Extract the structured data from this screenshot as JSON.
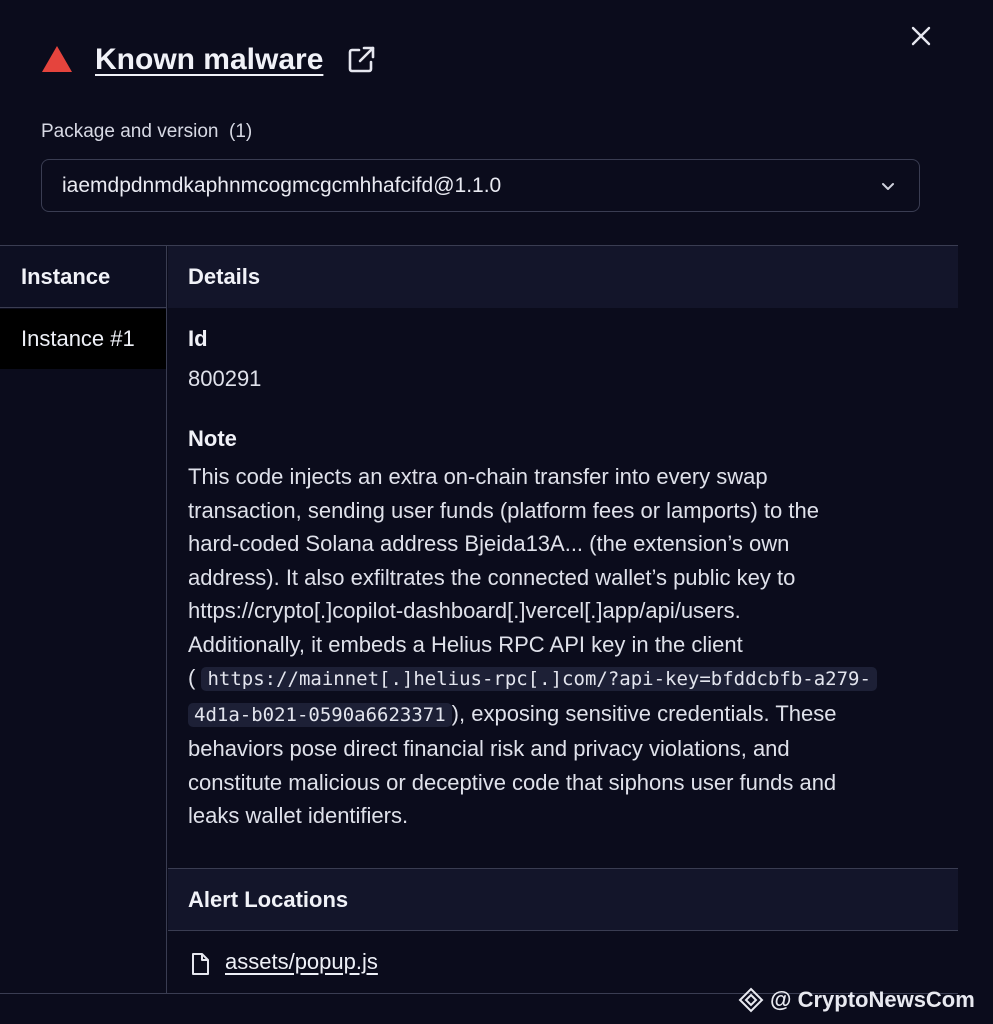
{
  "header": {
    "title": "Known malware",
    "package_label": "Package and version",
    "package_count": "(1)",
    "package_value": "iaemdpdnmdkaphnmcogmcgcmhhafcifd@1.1.0"
  },
  "instances": {
    "header": "Instance",
    "items": [
      "Instance #1"
    ]
  },
  "details": {
    "header": "Details",
    "id_label": "Id",
    "id_value": "800291",
    "note_label": "Note",
    "note_lines": [
      "This code injects an extra on-chain transfer into every swap",
      "transaction, sending user funds (platform fees or lamports) to the",
      "hard-coded Solana address Bjeida13A... (the extension’s own",
      "address). It also exfiltrates the connected wallet’s public key to",
      "https://crypto[.]copilot-dashboard[.]vercel[.]app/api/users.",
      "Additionally, it embeds a Helius RPC API key in the client"
    ],
    "note_code_prefix": "(",
    "note_code_1": "https://mainnet[.]helius-rpc[.]com/?api-key=bfddcbfb-a279-",
    "note_code_2": "4d1a-b021-0590a6623371",
    "note_after_code": "), exposing sensitive credentials. These",
    "note_tail_lines": [
      "behaviors pose direct financial risk and privacy violations, and",
      "constitute malicious or deceptive code that siphons user funds and",
      "leaks wallet identifiers."
    ]
  },
  "alert_locations": {
    "header": "Alert Locations",
    "file": "assets/popup.js"
  },
  "watermark": {
    "text": "@ CryptoNewsCom"
  },
  "colors": {
    "background": "#0b0c1c",
    "header_row": "#13152a",
    "alert_red": "#e5443d",
    "border": "#3a3d52"
  }
}
